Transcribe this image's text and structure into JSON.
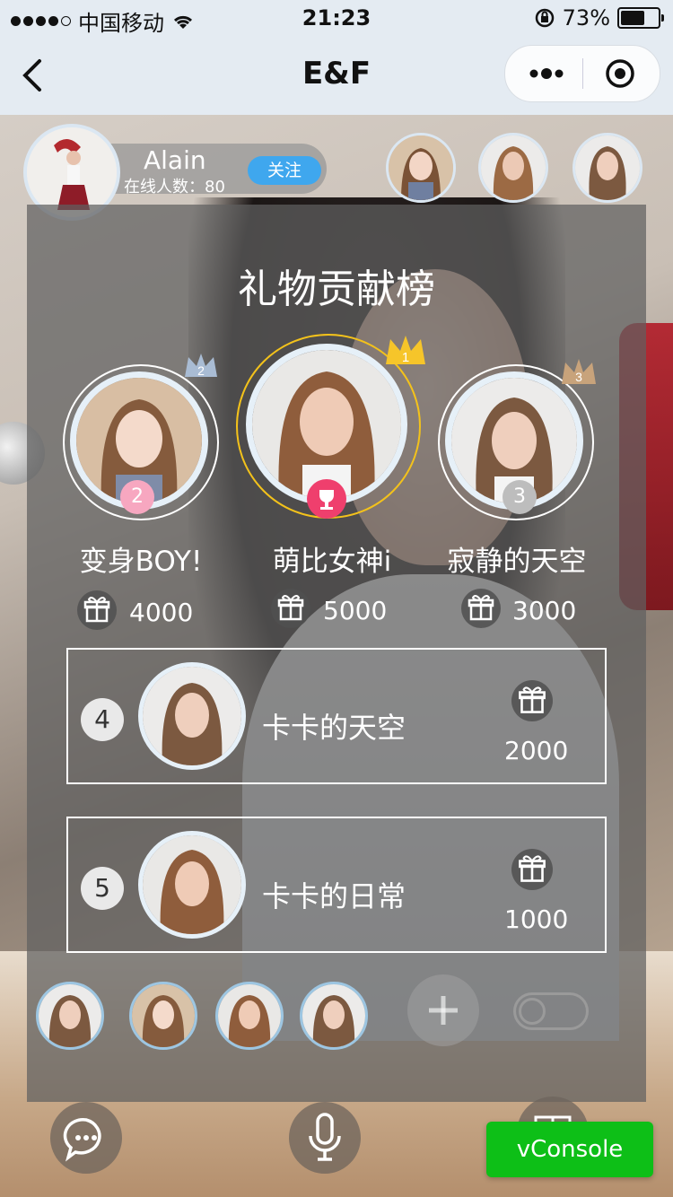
{
  "status_bar": {
    "carrier": "中国移动",
    "time": "21:23",
    "battery_text": "73%",
    "battery_level": 0.73,
    "signal_bars_filled": 4,
    "signal_bars_total": 5
  },
  "nav": {
    "title": "E&F"
  },
  "host": {
    "name": "Alain",
    "online_label": "在线人数：80",
    "follow_label": "关注"
  },
  "panel": {
    "title": "礼物贡献榜"
  },
  "podium": [
    {
      "rank": "2",
      "name": "变身BOY!",
      "gift": "4000"
    },
    {
      "rank": "1",
      "name": "萌比女神i",
      "gift": "5000"
    },
    {
      "rank": "3",
      "name": "寂静的天空",
      "gift": "3000"
    }
  ],
  "list": [
    {
      "rank": "4",
      "name": "卡卡的天空",
      "gift": "2000"
    },
    {
      "rank": "5",
      "name": "卡卡的日常",
      "gift": "1000"
    }
  ],
  "vconsole_label": "vConsole",
  "colors": {
    "follow": "#3fa7ee",
    "rank1_badge": "#ef3f6d",
    "rank2_badge": "#f7a7c0",
    "rank3_badge": "#bdbdbd",
    "gold_ring": "#f3c21b",
    "vconsole": "#0dbf17"
  }
}
